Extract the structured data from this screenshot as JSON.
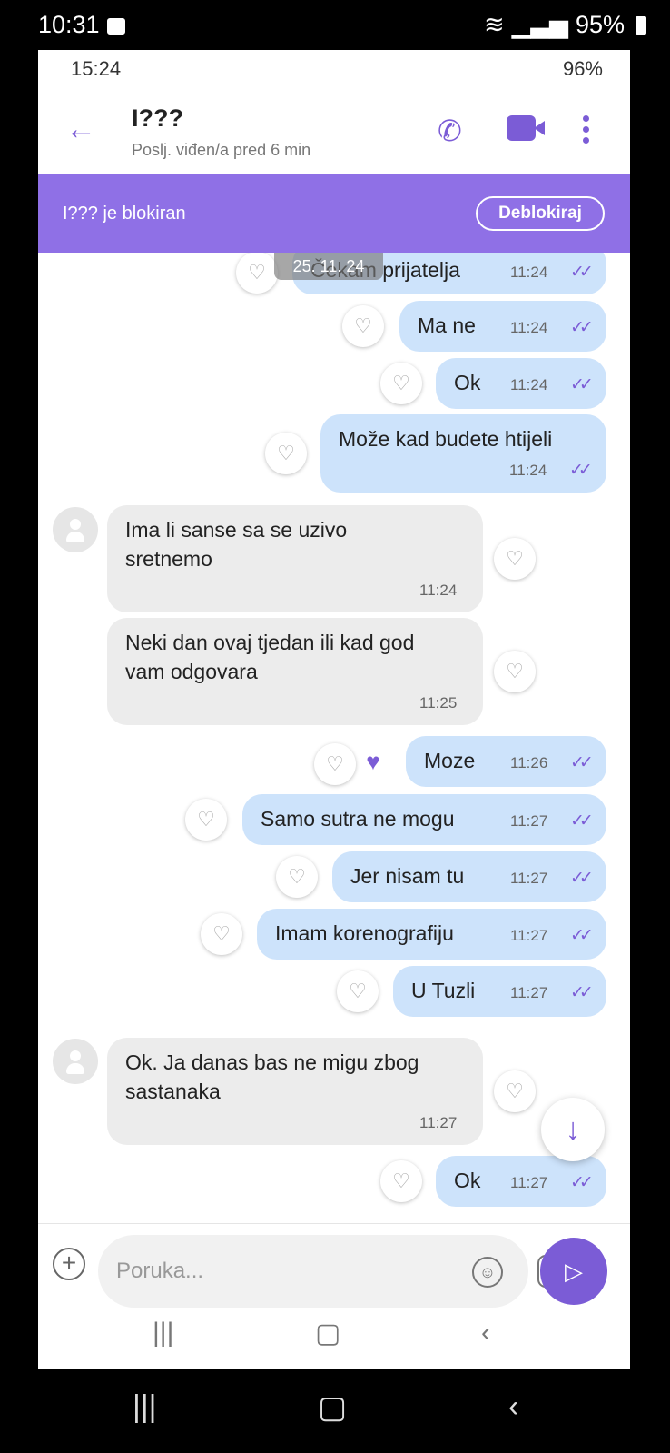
{
  "outer_status": {
    "time": "10:31",
    "battery": "95%"
  },
  "inner_status": {
    "time": "15:24",
    "battery": "96%"
  },
  "header": {
    "back": "←",
    "title": "I???",
    "subtitle": "Poslj. viđen/a pred 6 min"
  },
  "block_bar": {
    "text": "I??? je blokiran",
    "button": "Deblokiraj"
  },
  "date_chip": "25. 11. 24",
  "messages": [
    {
      "dir": "out",
      "text": "Čekam prijatelja",
      "time": "11:24"
    },
    {
      "dir": "out",
      "text": "Ma ne",
      "time": "11:24"
    },
    {
      "dir": "out",
      "text": "Ok",
      "time": "11:24"
    },
    {
      "dir": "out",
      "text": "Može kad budete htijeli",
      "time": "11:24"
    },
    {
      "dir": "in",
      "line1": "Ima li sanse sa se uzivo",
      "line2": "sretnemo",
      "time": "11:24"
    },
    {
      "dir": "in",
      "line1": "Neki dan ovaj tjedan ili kad god",
      "line2": "vam odgovara",
      "time": "11:25"
    },
    {
      "dir": "out",
      "text": "Moze",
      "time": "11:26"
    },
    {
      "dir": "out",
      "text": "Samo sutra ne mogu",
      "time": "11:27"
    },
    {
      "dir": "out",
      "text": "Jer nisam tu",
      "time": "11:27"
    },
    {
      "dir": "out",
      "text": "Imam korenografiju",
      "time": "11:27"
    },
    {
      "dir": "out",
      "text": "U Tuzli",
      "time": "11:27"
    },
    {
      "dir": "in",
      "line1": "Ok. Ja danas bas ne migu zbog",
      "line2": "sastanaka",
      "time": "11:27"
    },
    {
      "dir": "out",
      "text": "Ok",
      "time": "11:27"
    }
  ],
  "composer": {
    "placeholder": "Poruka..."
  },
  "icons": {
    "heart": "♡",
    "heart_filled": "♥",
    "ticks": "✓✓",
    "down": "↓",
    "send": "▷",
    "plus": "+"
  }
}
